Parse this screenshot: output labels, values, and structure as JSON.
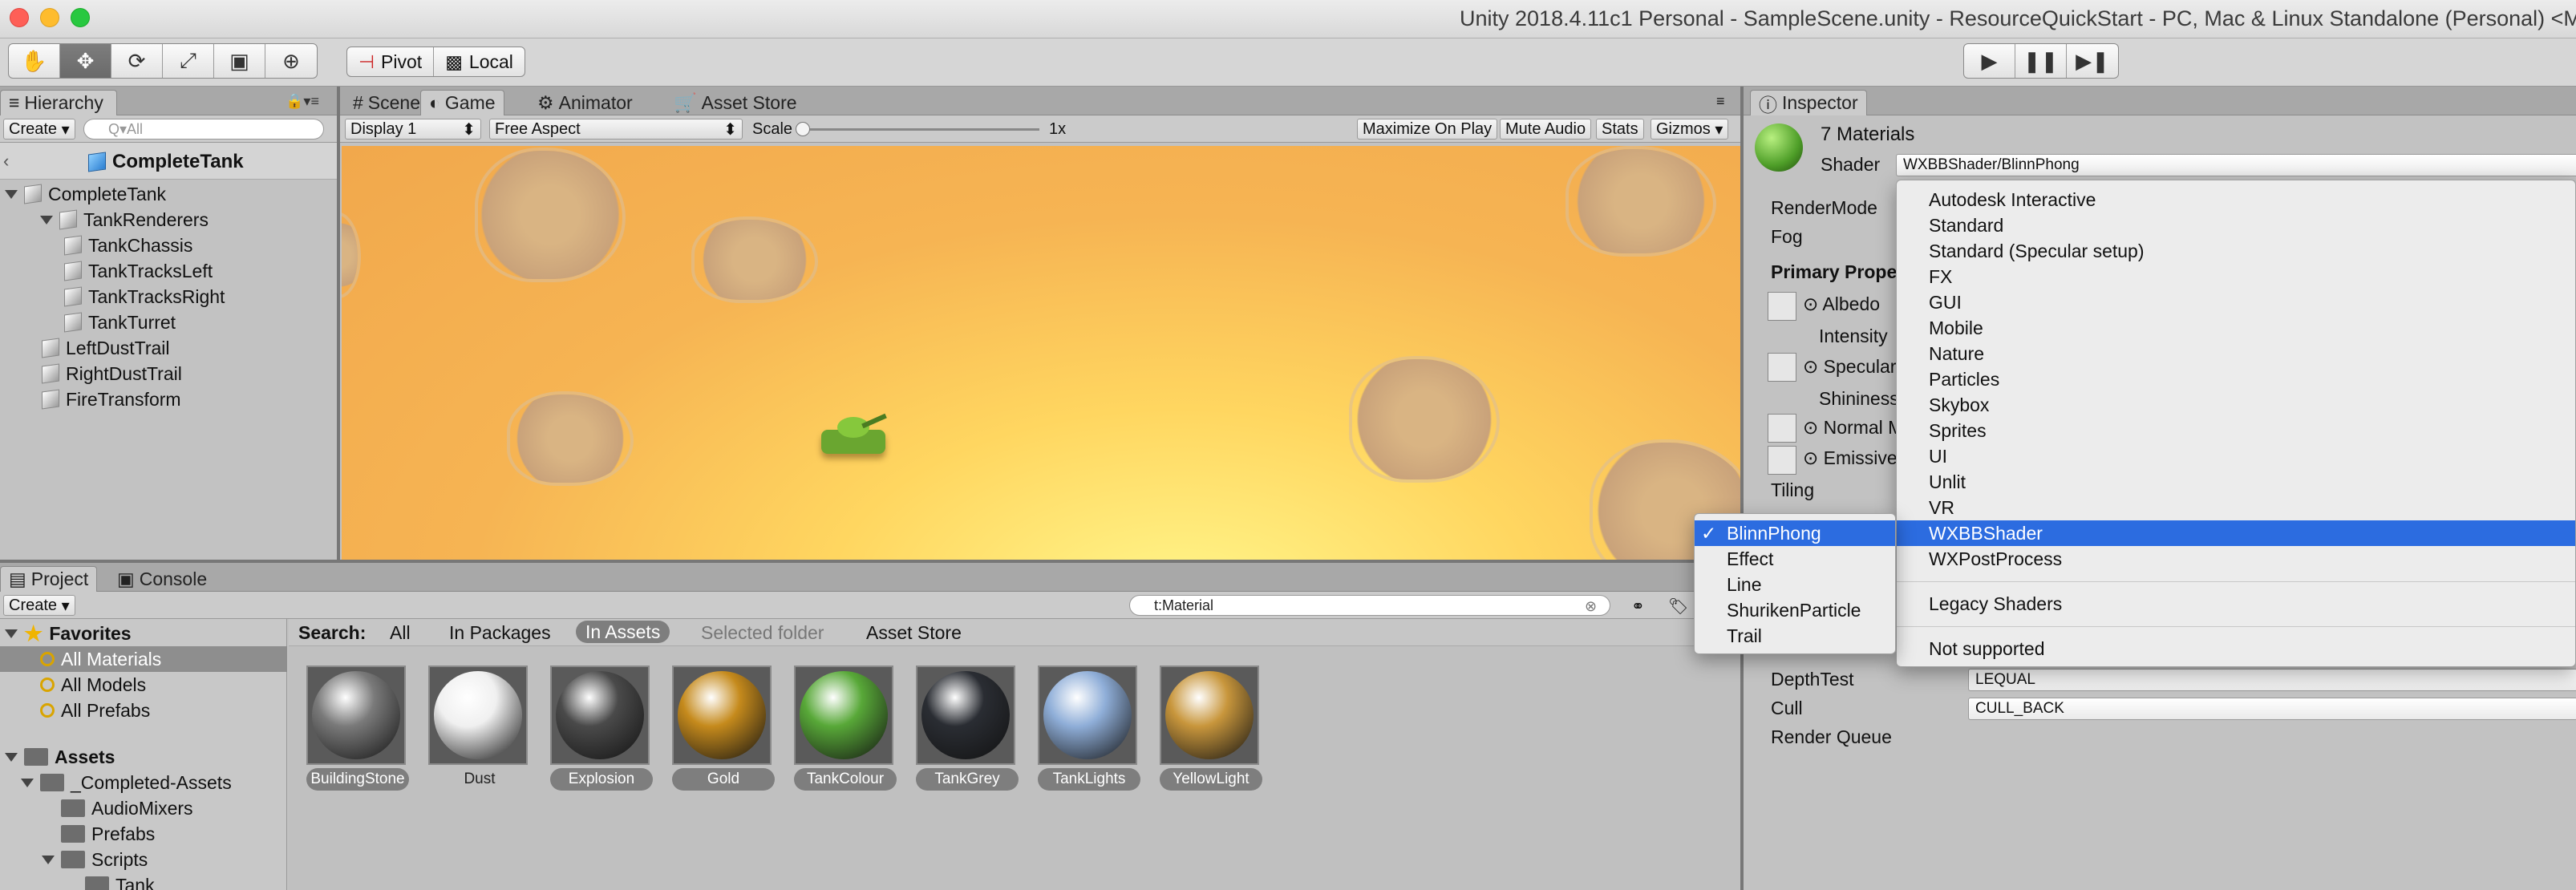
{
  "window": {
    "title": "Unity 2018.4.11c1 Personal - SampleScene.unity - ResourceQuickStart - PC, Mac & Linux Standalone (Personal) <M"
  },
  "toolbar": {
    "pivot_label": "Pivot",
    "local_label": "Local",
    "transform_tools": [
      "hand-tool-icon",
      "move-tool-icon",
      "rotate-tool-icon",
      "scale-tool-icon",
      "rect-tool-icon",
      "transform-tool-icon"
    ],
    "play_controls": [
      "play-icon",
      "pause-icon",
      "step-icon"
    ]
  },
  "hierarchy": {
    "tab_label": "Hierarchy",
    "create_label": "Create",
    "search_placeholder": "Q▾All",
    "breadcrumb": "CompleteTank",
    "items": [
      {
        "label": "CompleteTank"
      },
      {
        "label": "TankRenderers"
      },
      {
        "label": "TankChassis"
      },
      {
        "label": "TankTracksLeft"
      },
      {
        "label": "TankTracksRight"
      },
      {
        "label": "TankTurret"
      },
      {
        "label": "LeftDustTrail"
      },
      {
        "label": "RightDustTrail"
      },
      {
        "label": "FireTransform"
      }
    ]
  },
  "center": {
    "tabs": [
      "Scene",
      "Game",
      "Animator",
      "Asset Store"
    ],
    "active_tab": "Game",
    "display": "Display 1",
    "aspect": "Free Aspect",
    "scale_label": "Scale",
    "scale_value": "1x",
    "buttons": [
      "Maximize On Play",
      "Mute Audio",
      "Stats",
      "Gizmos"
    ]
  },
  "project": {
    "tabs": [
      "Project",
      "Console"
    ],
    "create_label": "Create",
    "search_value": "t:Material",
    "search_label": "Search:",
    "filters": [
      "All",
      "In Packages",
      "In Assets",
      "Selected folder",
      "Asset Store"
    ],
    "active_filter": "In Assets",
    "favorites_label": "Favorites",
    "favorites": [
      "All Materials",
      "All Models",
      "All Prefabs"
    ],
    "assets_label": "Assets",
    "assets_tree": [
      "_Completed-Assets",
      "AudioMixers",
      "Prefabs",
      "Scripts",
      "Tank"
    ],
    "materials": [
      {
        "name": "BuildingStone",
        "color": "#7a7a7a"
      },
      {
        "name": "Dust",
        "color": "#f0f0f0"
      },
      {
        "name": "Explosion",
        "color": "#4a4a4a"
      },
      {
        "name": "Gold",
        "color": "#c58a1c"
      },
      {
        "name": "TankColour",
        "color": "#58a838"
      },
      {
        "name": "TankGrey",
        "color": "#2a2d33"
      },
      {
        "name": "TankLights",
        "color": "#8faed8"
      },
      {
        "name": "YellowLight",
        "color": "#c8963c"
      }
    ]
  },
  "inspector": {
    "tab_label": "Inspector",
    "header": "7 Materials",
    "shader_label": "Shader",
    "shader_value": "WXBBShader/BlinnPhong",
    "labels": [
      "RenderMode",
      "Fog",
      "Primary Prope",
      "Albedo",
      "Intensity",
      "Specular",
      "Shininess",
      "Normal M",
      "Emissive",
      "Tiling",
      "DepthTest",
      "Cull",
      "Render Queue"
    ],
    "depth_test_value": "LEQUAL",
    "cull_value": "CULL_BACK"
  },
  "shader_menu": {
    "items": [
      "Autodesk Interactive",
      "Standard",
      "Standard (Specular setup)",
      "FX",
      "GUI",
      "Mobile",
      "Nature",
      "Particles",
      "Skybox",
      "Sprites",
      "UI",
      "Unlit",
      "VR",
      "WXBBShader",
      "WXPostProcess"
    ],
    "selected": "WXBBShader",
    "legacy": "Legacy Shaders",
    "not_supported": "Not supported"
  },
  "sub_menu": {
    "items": [
      "BlinnPhong",
      "Effect",
      "Line",
      "ShurikenParticle",
      "Trail"
    ],
    "checked": "BlinnPhong",
    "check_mark": "✓"
  },
  "colors": {
    "selection": "#2c6ce0",
    "panel": "#c2c2c2"
  }
}
